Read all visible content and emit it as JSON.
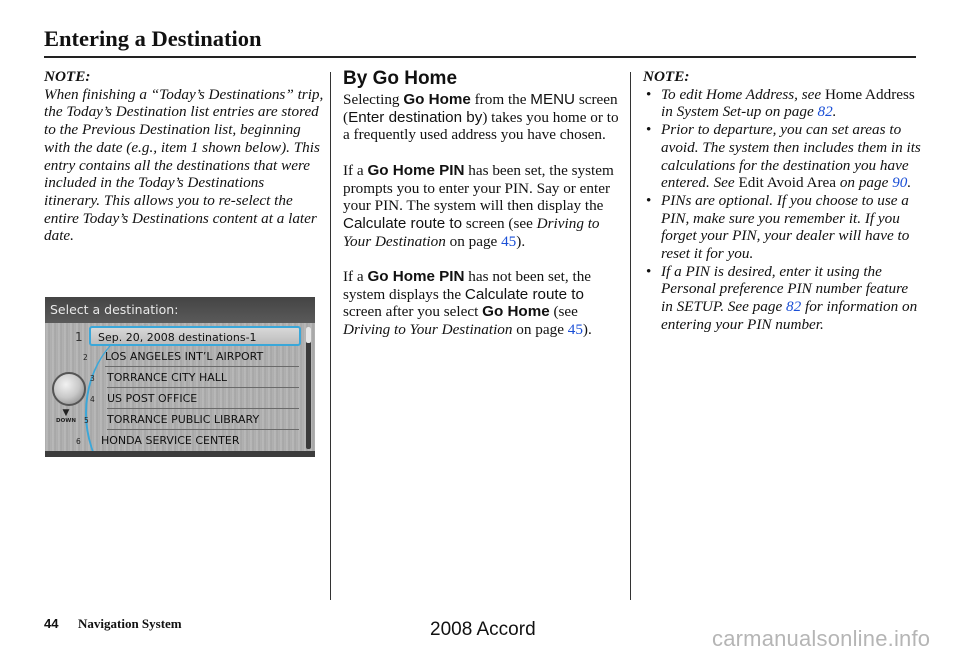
{
  "header": {
    "title": "Entering a Destination"
  },
  "left_column": {
    "note_label": "NOTE:",
    "note_text": "When finishing a “Today’s Destinations” trip, the Today’s Destination list entries are stored to the Previous Destination list, beginning with the date (e.g., item  1 shown below). This entry contains all the destinations that were included in the Today’s Destinations itinerary. This allows you to re-select the entire Today’s Destinations content at a later date."
  },
  "nav_screen": {
    "header": "Select a destination:",
    "down_label": "DOWN",
    "accent_color": "#3aa7d9",
    "rows": [
      {
        "num": "1",
        "label": "Sep. 20, 2008 destinations-1",
        "selected": true
      },
      {
        "num": "2",
        "label": "LOS ANGELES INT’L AIRPORT"
      },
      {
        "num": "3",
        "label": "TORRANCE CITY HALL"
      },
      {
        "num": "4",
        "label": "US POST OFFICE"
      },
      {
        "num": "5",
        "label": "TORRANCE PUBLIC LIBRARY"
      },
      {
        "num": "6",
        "label": "HONDA SERVICE CENTER"
      }
    ]
  },
  "middle_column": {
    "heading": "By Go Home",
    "p1": {
      "t1": "Selecting ",
      "b1": "Go Home",
      "t2": " from the ",
      "s1": "MENU",
      "t3": " screen (",
      "s2": "Enter destination by",
      "t4": ") takes you home or to a frequently used address you have chosen."
    },
    "p2": {
      "t1": "If a ",
      "b1": "Go Home PIN",
      "t2": " has been set, the system prompts you to enter your PIN. Say or enter your PIN. The system will then display the ",
      "s1": "Calculate route to",
      "t3": " screen (see ",
      "i1": "Driving to Your Destination",
      "t4": " on page ",
      "link": "45",
      "t5": ")."
    },
    "p3": {
      "t1": "If a ",
      "b1": "Go Home PIN",
      "t2": " has not been set, the system displays the ",
      "s1": "Calculate route to",
      "t3": " screen after you select ",
      "b2": "Go Home",
      "t4": " (see ",
      "i1": "Driving to Your Destination",
      "t5": " on page ",
      "link": "45",
      "t6": ")."
    }
  },
  "right_column": {
    "note_label": "NOTE:",
    "bullets": [
      {
        "i1": "To edit Home Address, see ",
        "r1": "Home Address",
        "i2": " in System Set-up on page ",
        "link": "82",
        "i3": "."
      },
      {
        "i1": "Prior to departure, you can set areas to avoid. The system then includes them in its calculations for the destination you have entered. See ",
        "r1": "Edit Avoid Area",
        "i2": " on page ",
        "link": "90",
        "i3": "."
      },
      {
        "i1": "PINs are optional. If you choose to use a PIN, make sure you remember it. If you forget your PIN, your dealer will have to reset it for you."
      },
      {
        "i1": "If a PIN is desired, enter it using the Personal preference PIN number feature in SETUP. See page ",
        "link": "82",
        "i2": " for information on entering your PIN number."
      }
    ]
  },
  "footer": {
    "page_number": "44",
    "section": "Navigation System",
    "model": "2008  Accord",
    "watermark": "carmanualsonline.info"
  }
}
